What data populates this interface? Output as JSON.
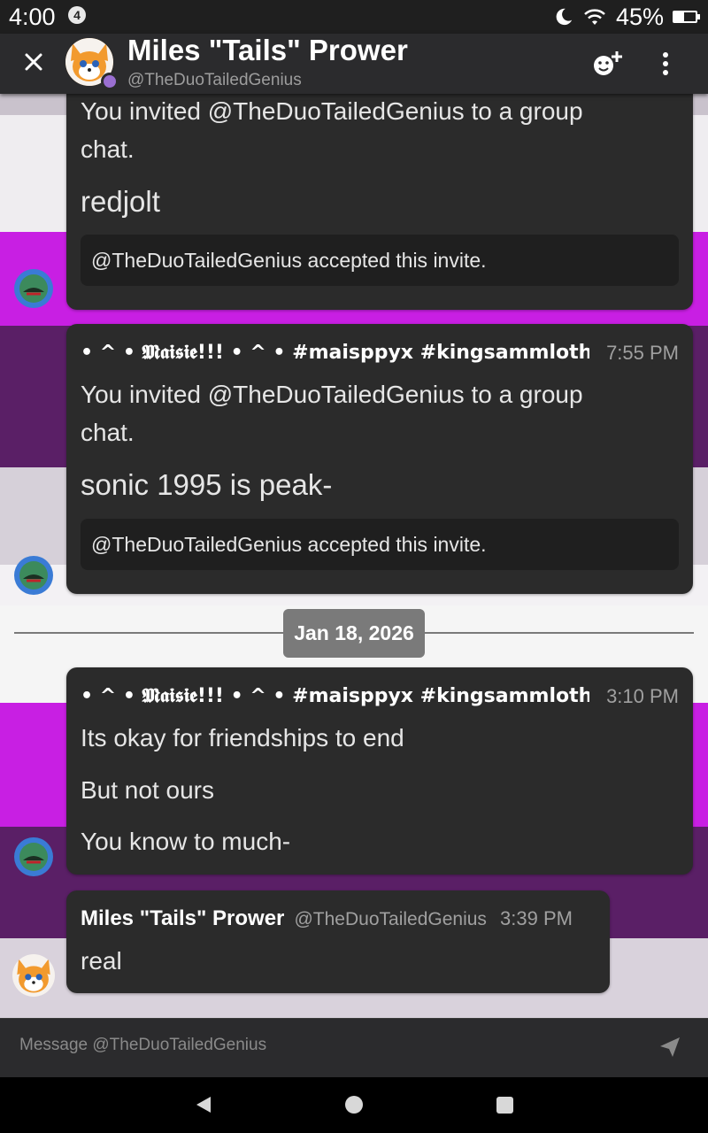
{
  "status_bar": {
    "time": "4:00",
    "notification_count": "4",
    "battery": "45%",
    "battery_level": 0.45,
    "icons": [
      "moon-icon",
      "wifi-icon",
      "battery-icon"
    ]
  },
  "header": {
    "name": "Miles \"Tails\" Prower",
    "handle": "@TheDuoTailedGenius",
    "close_icon": "close-icon",
    "add_friend_icon": "add-friend-icon",
    "more_icon": "more-vertical-icon"
  },
  "messages": [
    {
      "text_lines": [
        "You invited @TheDuoTailedGenius to a group",
        "chat."
      ],
      "big_text": "redjolt",
      "embed": "@TheDuoTailedGenius accepted this invite."
    },
    {
      "author": "• ^ • 𝕸𝖆𝖎𝖘𝖎𝖊!!! • ^ • #maisppyx #kingsammlothar",
      "time": "7:55 PM",
      "text_lines": [
        "You invited @TheDuoTailedGenius to a group",
        "chat."
      ],
      "big_text": "sonic 1995 is peak-",
      "embed": "@TheDuoTailedGenius accepted this invite."
    },
    {
      "author": "• ^ • 𝕸𝖆𝖎𝖘𝖎𝖊!!! • ^ • #maisppyx #kingsammlothar",
      "time": "3:10 PM",
      "lines": [
        "Its okay for friendships to end",
        "But not ours",
        "You know to much-"
      ]
    },
    {
      "author": "Miles \"Tails\" Prower",
      "handle": "@TheDuoTailedGenius",
      "time": "3:39 PM",
      "text": "real"
    }
  ],
  "date_separator": "Jan 18, 2026",
  "input": {
    "placeholder": "Message @TheDuoTailedGenius",
    "send_icon": "send-icon"
  },
  "nav": {
    "back_icon": "back-icon",
    "home_icon": "home-icon",
    "recents_icon": "recents-icon"
  },
  "colors": {
    "bubble": "#2b2b2b",
    "background": "#2b2b2d",
    "stripe_magenta": "#c81fe3",
    "stripe_purple": "#5a1f66",
    "stripe_light": "#e8e4ea",
    "presence": "#9a6fd1"
  }
}
